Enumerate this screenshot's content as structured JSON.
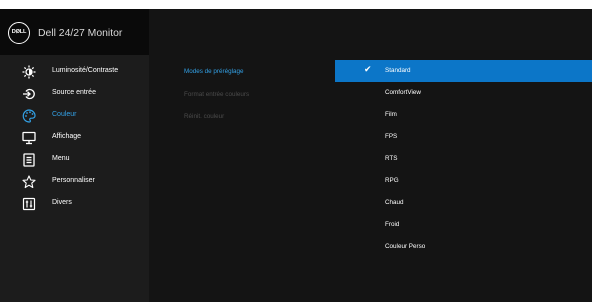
{
  "header": {
    "logo_text": "DØLL",
    "title": "Dell 24/27 Monitor"
  },
  "sidebar": {
    "items": [
      {
        "label": "Luminosité/Contraste",
        "icon": "brightness-icon",
        "active": false
      },
      {
        "label": "Source entrée",
        "icon": "input-source-icon",
        "active": false
      },
      {
        "label": "Couleur",
        "icon": "color-palette-icon",
        "active": true
      },
      {
        "label": "Affichage",
        "icon": "display-icon",
        "active": false
      },
      {
        "label": "Menu",
        "icon": "menu-icon",
        "active": false
      },
      {
        "label": "Personnaliser",
        "icon": "star-icon",
        "active": false
      },
      {
        "label": "Divers",
        "icon": "others-icon",
        "active": false
      }
    ]
  },
  "submenu": {
    "items": [
      {
        "label": "Modes de préréglage",
        "state": "active"
      },
      {
        "label": "Format entrée couleurs",
        "state": "disabled"
      },
      {
        "label": "Réinit. couleur",
        "state": "disabled"
      }
    ]
  },
  "options": {
    "selected_index": 0,
    "check_glyph": "✔",
    "items": [
      {
        "label": "Standard"
      },
      {
        "label": "ComfortView"
      },
      {
        "label": "Film"
      },
      {
        "label": "FPS"
      },
      {
        "label": "RTS"
      },
      {
        "label": "RPG"
      },
      {
        "label": "Chaud"
      },
      {
        "label": "Froid"
      },
      {
        "label": "Couleur Perso"
      }
    ]
  },
  "colors": {
    "accent": "#33a1e6",
    "selection": "#0c76c8",
    "sidebar_bg": "#1c1c1c",
    "panel_bg": "#141414",
    "disabled_text": "#4b4b4b"
  }
}
